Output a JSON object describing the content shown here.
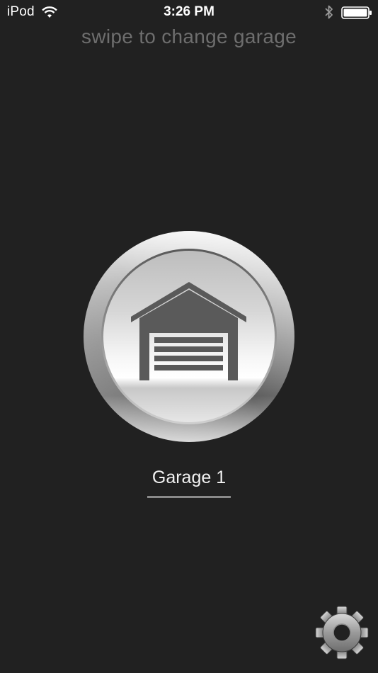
{
  "status_bar": {
    "carrier": "iPod",
    "time": "3:26 PM",
    "icons": [
      "wifi-icon",
      "bluetooth-icon",
      "battery-icon"
    ]
  },
  "instruction": "swipe to change garage",
  "door_button": {
    "icon": "garage-door-icon"
  },
  "garage": {
    "name": "Garage 1"
  },
  "settings": {
    "icon": "gear-icon"
  },
  "colors": {
    "background": "#212121",
    "instruction_text": "#6e6e6e",
    "label_text": "#f2f2f2",
    "underline": "#8a8a8a",
    "icon_gray": "#5a5a5a"
  }
}
